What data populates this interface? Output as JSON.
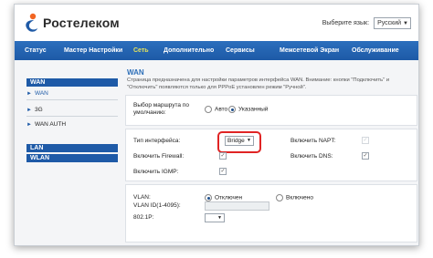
{
  "header": {
    "brand": "Ростелеком",
    "lang_label": "Выберите язык:",
    "lang_value": "Русский"
  },
  "nav": {
    "items": [
      {
        "label": "Статус",
        "active": false
      },
      {
        "label": "Мастер Настройки",
        "active": false
      },
      {
        "label": "Сеть",
        "active": true
      },
      {
        "label": "Дополнительно",
        "active": false
      },
      {
        "label": "Сервисы",
        "active": false
      },
      {
        "label": "Межсетевой Экран",
        "active": false
      },
      {
        "label": "Обслуживание",
        "active": false
      }
    ]
  },
  "sidebar": {
    "wan": "WAN",
    "wan_sub": [
      "WAN",
      "3G",
      "WAN AUTH"
    ],
    "lan": "LAN",
    "wlan": "WLAN"
  },
  "main": {
    "title": "WAN",
    "description": "Страница предназначена для настройки параметров интерфейса WAN. Внимание: кнопки \"Подключить\" и \"Отключить\" появляются только для PPPoE установлен режим \"Ручной\".",
    "route": {
      "label": "Выбор маршрута по умолчанию:",
      "auto": "Авто",
      "specified": "Указанный",
      "selected": "Указанный"
    },
    "iface": {
      "type_label": "Тип интерфейса:",
      "type_value": "Bridge",
      "napt_label": "Включить NAPT:",
      "firewall_label": "Включить Firewall:",
      "firewall_checked": true,
      "dns_label": "Включить DNS:",
      "dns_checked": true,
      "igmp_label": "Включить IGMP:",
      "igmp_checked": true
    },
    "vlan": {
      "label": "VLAN:",
      "off": "Отключен",
      "on": "Включено",
      "selected": "Отключен",
      "id_label": "VLAN ID(1-4095):",
      "p_label": "802.1P:"
    }
  },
  "colors": {
    "nav_blue": "#1d5aa6",
    "active_nav": "#e7e35a",
    "highlight": "#e02424"
  }
}
